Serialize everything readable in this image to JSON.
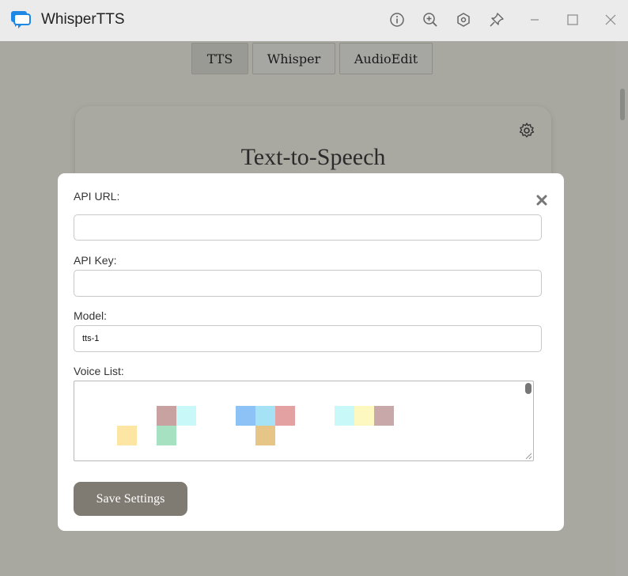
{
  "app": {
    "title": "WhisperTTS",
    "accent": "#1e88e5"
  },
  "titlebar_buttons": [
    "info-icon",
    "zoom-in-icon",
    "settings-hex-icon",
    "pin-icon",
    "minimize-icon",
    "maximize-icon",
    "close-window-icon"
  ],
  "tabs": [
    {
      "label": "TTS",
      "active": true
    },
    {
      "label": "Whisper",
      "active": false
    },
    {
      "label": "AudioEdit",
      "active": false
    }
  ],
  "card": {
    "title": "Text-to-Speech"
  },
  "modal": {
    "api_url": {
      "label": "API URL:",
      "value": ""
    },
    "api_key": {
      "label": "API Key:",
      "value": ""
    },
    "model": {
      "label": "Model:",
      "value": "tts-1"
    },
    "voice_list": {
      "label": "Voice List:"
    },
    "save_label": "Save Settings"
  },
  "colors": {
    "overlay": "#a8a8a0",
    "save_button": "#807b72",
    "modal_bg": "#ffffff"
  }
}
